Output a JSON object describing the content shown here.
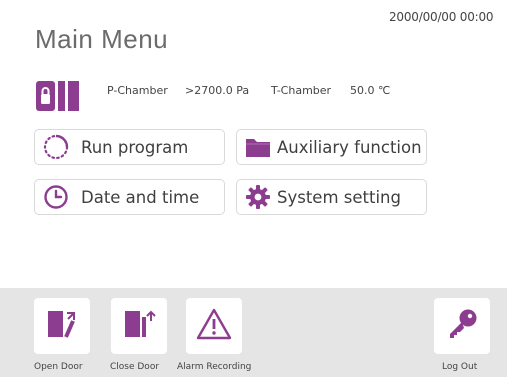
{
  "header": {
    "datetime": "2000/00/00 00:00",
    "title": "Main Menu"
  },
  "status": {
    "p_chamber_label": "P-Chamber",
    "p_chamber_value": ">2700.0 Pa",
    "t_chamber_label": "T-Chamber",
    "t_chamber_value": "50.0 ℃"
  },
  "menu": {
    "run_program": "Run program",
    "auxiliary_function": "Auxiliary function",
    "date_and_time": "Date and time",
    "system_setting": "System setting"
  },
  "footer": {
    "open_door": "Open Door",
    "close_door": "Close Door",
    "alarm_recording": "Alarm Recording",
    "log_out": "Log Out"
  },
  "icons": [
    "chamber-status-icon",
    "loading-circle-icon",
    "folder-icon",
    "clock-icon",
    "gear-icon",
    "open-door-icon",
    "close-door-icon",
    "warning-icon",
    "key-icon"
  ],
  "colors": {
    "accent": "#8c3d8f",
    "footer_bg": "#e5e5e5",
    "button_border": "#d9d9d9"
  }
}
